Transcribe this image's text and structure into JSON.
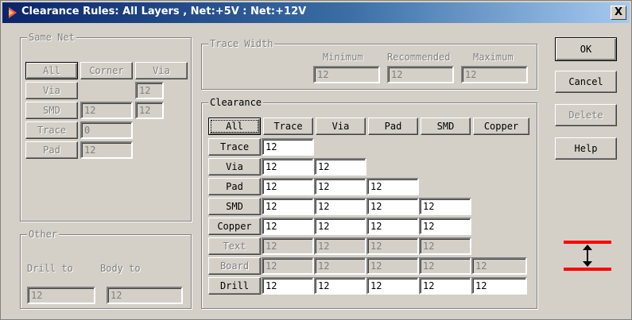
{
  "window": {
    "title": "Clearance Rules:  All Layers , Net:+5V : Net:+12V",
    "close_label": "X"
  },
  "same_net": {
    "legend": "Same Net",
    "headers": [
      "All",
      "Corner",
      "Via"
    ],
    "rows": [
      {
        "label": "Via",
        "corner": "",
        "via": "12"
      },
      {
        "label": "SMD",
        "corner": "12",
        "via": "12"
      },
      {
        "label": "Trace",
        "corner": "0",
        "via": ""
      },
      {
        "label": "Pad",
        "corner": "12",
        "via": ""
      }
    ]
  },
  "trace_width": {
    "legend": "Trace Width",
    "headers": [
      "Minimum",
      "Recommended",
      "Maximum"
    ],
    "values": [
      "12",
      "12",
      "12"
    ]
  },
  "clearance": {
    "legend": "Clearance",
    "all_label": "All",
    "columns": [
      "Trace",
      "Via",
      "Pad",
      "SMD",
      "Copper"
    ],
    "rows": [
      {
        "label": "Trace",
        "values": [
          "12"
        ]
      },
      {
        "label": "Via",
        "values": [
          "12",
          "12"
        ]
      },
      {
        "label": "Pad",
        "values": [
          "12",
          "12",
          "12"
        ]
      },
      {
        "label": "SMD",
        "values": [
          "12",
          "12",
          "12",
          "12"
        ]
      },
      {
        "label": "Copper",
        "values": [
          "12",
          "12",
          "12",
          "12"
        ]
      },
      {
        "label": "Text",
        "values": [
          "12",
          "12",
          "12",
          "12"
        ]
      },
      {
        "label": "Board",
        "values": [
          "12",
          "12",
          "12",
          "12",
          "12"
        ]
      },
      {
        "label": "Drill",
        "values": [
          "12",
          "12",
          "12",
          "12",
          "12"
        ]
      }
    ]
  },
  "other": {
    "legend": "Other",
    "drill_label": "Drill to",
    "body_label": "Body to",
    "drill_value": "12",
    "body_value": "12"
  },
  "buttons": {
    "ok": "OK",
    "cancel": "Cancel",
    "delete": "Delete",
    "help": "Help"
  },
  "colors": {
    "rule_line": "#ff0000",
    "title_start": "#0a246a",
    "title_end": "#a6caf0"
  },
  "icons": {
    "clearance_graphic": "clearance-arrow-icon",
    "app": "app-icon"
  }
}
